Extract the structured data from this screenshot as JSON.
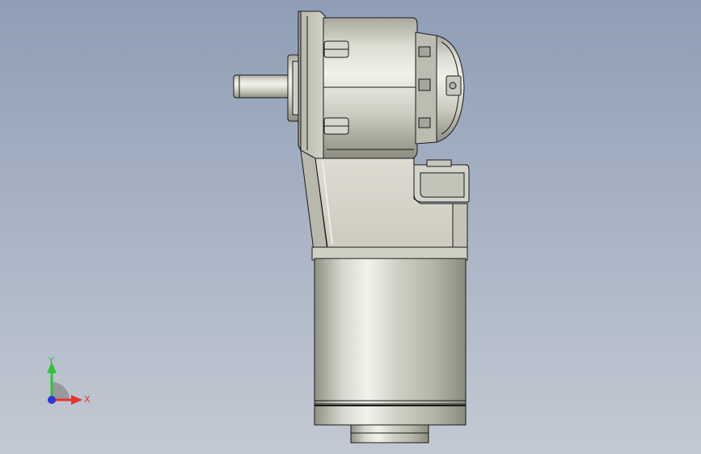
{
  "view": {
    "background_top": "#8f9eb6",
    "background_bottom": "#c3c9d3",
    "model_fill": "#d9d9cf",
    "model_shadow": "#9b9b90",
    "model_highlight": "#f4f4ee",
    "edge_color": "#1a1a1a"
  },
  "triad": {
    "x_label": "X",
    "y_label": "Y",
    "x_color": "#e8322e",
    "y_color": "#31c23a",
    "z_color": "#2b35e0"
  }
}
